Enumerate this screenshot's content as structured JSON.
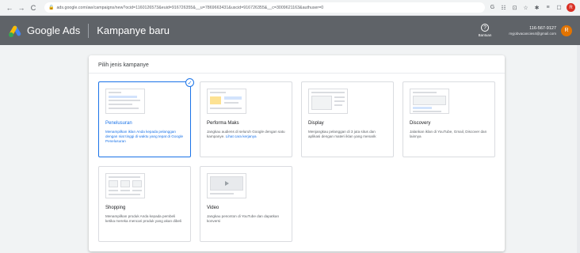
{
  "browser": {
    "url": "ads.google.com/aw/campaigns/new?ocid=1160126573&euid=916726355&__u=7869663431&uscid=916726355&__c=3009621163&authuser=0",
    "nav": {
      "back": "←",
      "forward": "→",
      "reload": "C"
    },
    "lock": "🔒",
    "ext_icons": [
      "G",
      "☷",
      "⊡",
      "☆",
      "✱",
      "≡",
      "☐"
    ],
    "profile_initial": "R"
  },
  "header": {
    "brand": "Google Ads",
    "page_title": "Kampanye baru",
    "help_label": "Bantuan",
    "help_icon": "?",
    "account_id": "116-567-9127",
    "account_email": "myjobvacancies4@gmail.com",
    "avatar_initial": "R"
  },
  "panel": {
    "title": "Pilih jenis kampanye",
    "cards": [
      {
        "title": "Penelusuran",
        "desc": "Menampilkan iklan Anda kepada pelanggan dengan niat tinggi di waktu yang tepat di Google Penelusuran",
        "selected": true
      },
      {
        "title": "Performa Maks",
        "desc": "Jangkau audiens di seluruh Google dengan satu kampanye.",
        "link": "Lihat cara kerjanya"
      },
      {
        "title": "Display",
        "desc": "Menjangkau pelanggan di 3 juta situs dan aplikasi dengan materi iklan yang menarik"
      },
      {
        "title": "Discovery",
        "desc": "Jalankan iklan di YouTube, Gmail, Discover dan lainnya"
      },
      {
        "title": "Shopping",
        "desc": "Menampilkan produk Anda kepada pembeli ketika mereka mencari produk yang akan dibeli"
      },
      {
        "title": "Video",
        "desc": "Jangkau penonton di YouTube dan dapatkan konversi"
      }
    ],
    "check_icon": "✓"
  }
}
